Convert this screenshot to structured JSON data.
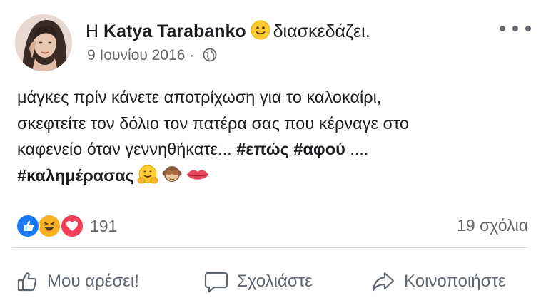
{
  "post": {
    "author_prefix": "Η",
    "author_name": "Katya Tarabanko",
    "activity": "διασκεδάζει.",
    "date": "9 Ιουνίου 2016",
    "separator": "·",
    "privacy_icon": "globe-icon",
    "feeling_icon": "slightly-smiling-face-icon",
    "text_lines": [
      "μάγκες  πρίν κάνετε αποτρίχωση για το καλοκαίρι,",
      "σκεφτείτε τον δόλιο τον πατέρα σας που κέρναγε στο",
      "καφενείο όταν γεννηθήκατε..."
    ],
    "hashtag_1": "#επώς",
    "hashtag_2": "#αφού",
    "trailing_dots": "....",
    "hashtag_3": "#καλημέρασας",
    "emojis": [
      "hugging-face-icon",
      "see-no-evil-monkey-icon",
      "lips-icon"
    ]
  },
  "reactions": {
    "types": [
      "like-icon",
      "haha-icon",
      "love-icon"
    ],
    "count": "191"
  },
  "comments": {
    "count_label": "19 σχόλια"
  },
  "actions": {
    "like_label": "Μου αρέσει!",
    "comment_label": "Σχολιάστε",
    "share_label": "Κοινοποιήστε"
  },
  "colors": {
    "like_blue": "#1877f2",
    "love_red": "#f33e58",
    "haha_yellow": "#f7b125",
    "text_gray": "#65676b"
  }
}
